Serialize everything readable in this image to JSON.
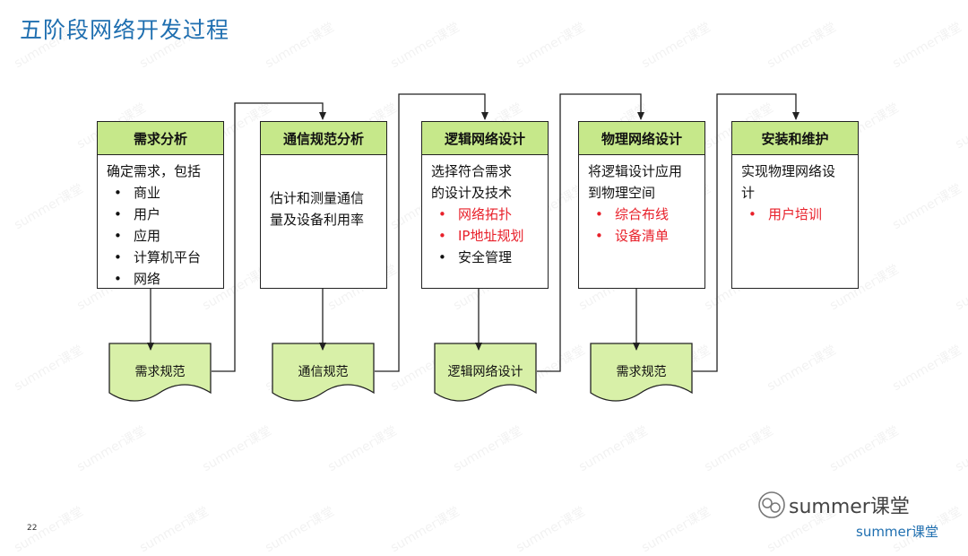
{
  "title": "五阶段网络开发过程",
  "stages": [
    {
      "header": "需求分析",
      "intro": "确定需求，包括",
      "bullets": [
        {
          "mark": "•",
          "text": "商业"
        },
        {
          "mark": "•",
          "text": "用户"
        },
        {
          "mark": "•",
          "text": "应用"
        },
        {
          "mark": "•",
          "text": "计算机平台"
        },
        {
          "mark": "•",
          "text": "网络"
        }
      ]
    },
    {
      "header": "通信规范分析",
      "lines": [
        "估计和测量通信",
        "量及设备利用率"
      ]
    },
    {
      "header": "逻辑网络设计",
      "lines": [
        "选择符合需求",
        "的设计及技术"
      ],
      "bullets": [
        {
          "mark": "•",
          "text": "网络拓扑"
        },
        {
          "mark": "•",
          "text": "IP地址规划"
        },
        {
          "mark": "•",
          "text": "安全管理"
        }
      ]
    },
    {
      "header": "物理网络设计",
      "lines": [
        "将逻辑设计应用",
        "到物理空间"
      ],
      "bullets": [
        {
          "mark": "•",
          "text": "综合布线"
        },
        {
          "mark": "•",
          "text": "设备清单"
        }
      ]
    },
    {
      "header": "安装和维护",
      "lines": [
        "实现物理网络设",
        "计"
      ],
      "bullets": [
        {
          "mark": "•",
          "text": "用户培训"
        }
      ]
    }
  ],
  "documents": [
    "需求规范",
    "通信规范",
    "逻辑网络设计",
    "需求规范"
  ],
  "page_number": "22",
  "brand": {
    "logo_text": "summer课堂",
    "footer_text": "summer课堂"
  },
  "watermark_text": "summer课堂",
  "colors": {
    "header_fill": "#c6e88a",
    "doc_fill": "#d8f0a8",
    "title": "#1f6fb0",
    "highlight": "#e8202a"
  }
}
